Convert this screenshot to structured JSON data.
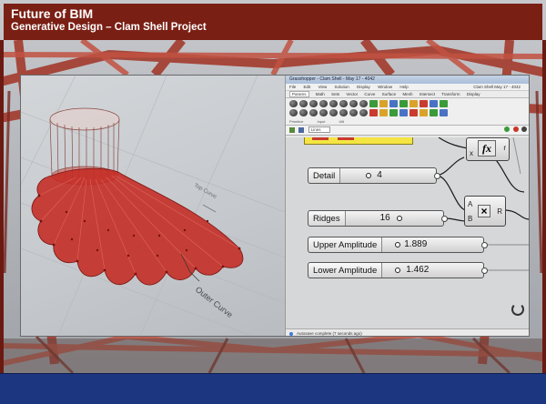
{
  "slide": {
    "title": "Future of BIM",
    "subtitle": "Generative Design – Clam Shell Project"
  },
  "viewport": {
    "outer_curve_label": "Outer Curve",
    "top_curve_label": "Top Curve"
  },
  "grasshopper": {
    "window_title": "Grasshopper - Clam Shell - May 17 - 4042",
    "window_title_right": "",
    "menu": [
      "File",
      "Edit",
      "View",
      "Solution",
      "Display",
      "Window",
      "Help"
    ],
    "menu_right": "Clam Shell  May 17 - 4042",
    "tabs": [
      "Params",
      "Math",
      "Sets",
      "Vector",
      "Curve",
      "Surface",
      "Mesh",
      "Intersect",
      "Transform",
      "Display"
    ],
    "active_tab": "Params",
    "toolbar_groups": [
      "Primitive",
      "Input",
      "Util"
    ],
    "zoom_field": "Lines",
    "sliders": [
      {
        "label": "Detail",
        "value": "4"
      },
      {
        "label": "Ridges",
        "value": "16"
      },
      {
        "label": "Upper Amplitude",
        "value": "1.889"
      },
      {
        "label": "Lower Amplitude",
        "value": "1.462"
      }
    ],
    "multiply": {
      "in_a": "A",
      "in_b": "B",
      "out": "R",
      "symbol": "×"
    },
    "expression": {
      "in_x": "x",
      "symbol": "fx",
      "out": "r"
    },
    "status": "Autosave complete (7 seconds ago)",
    "status_right": ""
  },
  "colors": {
    "title_bar": "#7a1f14",
    "bottom_band": "#1c3680",
    "shell_red": "#c42a22"
  }
}
